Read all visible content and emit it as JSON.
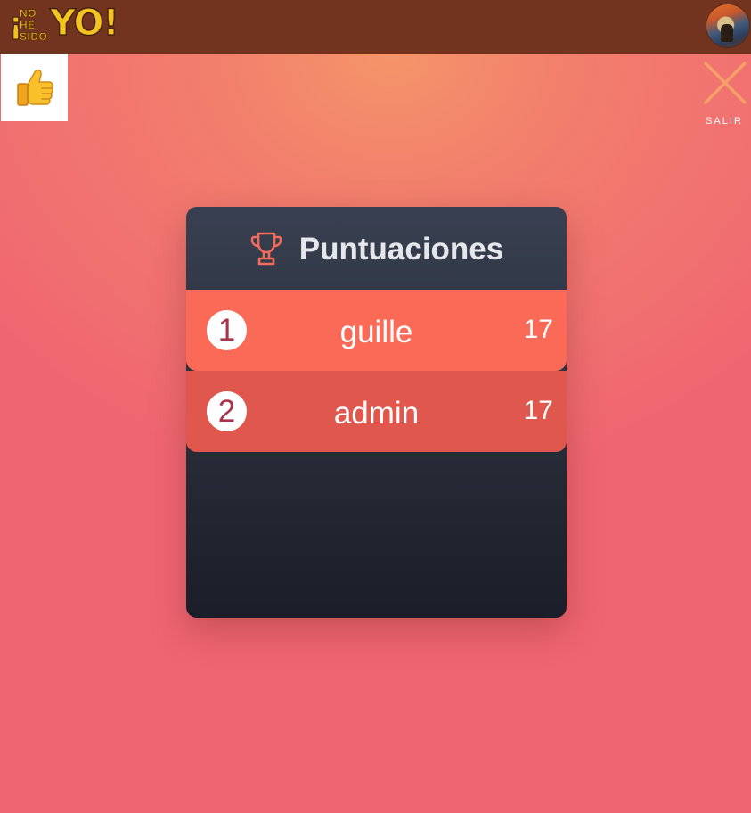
{
  "header": {
    "logo": {
      "exclamation_open": "¡",
      "words": [
        "NO",
        "HE",
        "SIDO"
      ],
      "yo": "YO!"
    },
    "avatar_icon": "scream-painting-avatar"
  },
  "like_icon": "thumbs-up-icon",
  "close": {
    "icon": "close-icon",
    "label": "SALIR",
    "color": "#f4a067"
  },
  "scores": {
    "icon": "trophy-icon",
    "title": "Puntuaciones",
    "rows": [
      {
        "rank": "1",
        "name": "guille",
        "score": "17",
        "color": "#fa6a56"
      },
      {
        "rank": "2",
        "name": "admin",
        "score": "17",
        "color": "#e0574e"
      }
    ]
  },
  "colors": {
    "topbar": "#72341f",
    "logo_yellow": "#f3c322",
    "trophy": "#f26b5b",
    "panel": "#2a303c"
  }
}
